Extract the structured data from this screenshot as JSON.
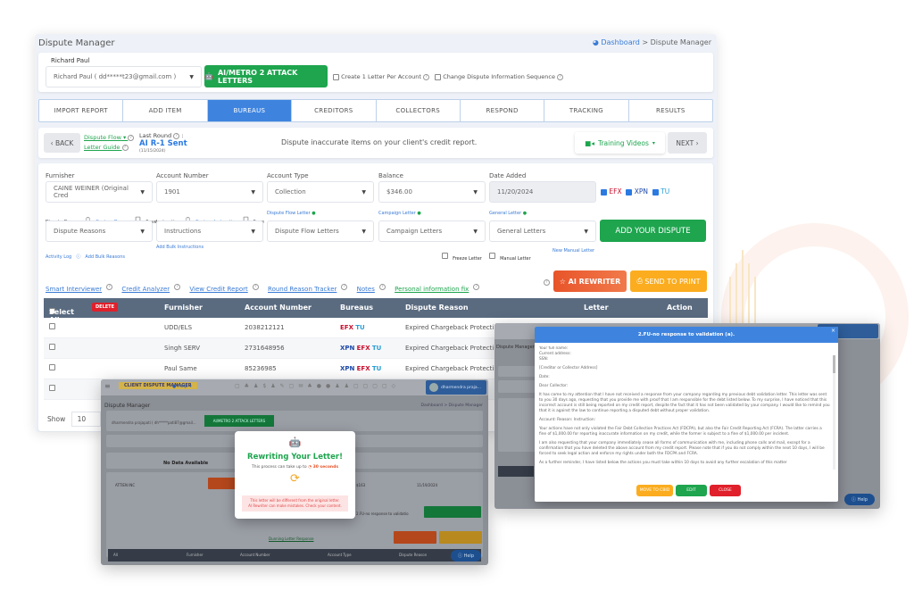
{
  "main": {
    "page_title": "Dispute Manager",
    "breadcrumb": {
      "home": "Dashboard",
      "sep": ">",
      "current": "Dispute Manager"
    },
    "client": {
      "label": "Richard Paul",
      "select_value": "Richard Paul ( dd*****t23@gmail.com )"
    },
    "attack_button": "AI/METRO 2 ATTACK LETTERS",
    "option_one_letter": "Create 1 Letter Per Account",
    "option_sequence": "Change Dispute Information Sequence",
    "tabs": [
      {
        "label": "IMPORT REPORT",
        "active": false
      },
      {
        "label": "ADD ITEM",
        "active": false
      },
      {
        "label": "BUREAUS",
        "active": true
      },
      {
        "label": "CREDITORS",
        "active": false
      },
      {
        "label": "COLLECTORS",
        "active": false
      },
      {
        "label": "RESPOND",
        "active": false
      },
      {
        "label": "TRACKING",
        "active": false
      },
      {
        "label": "RESULTS",
        "active": false
      }
    ],
    "nav": {
      "back": "BACK",
      "next": "NEXT",
      "dispute_flow": "Dispute Flow",
      "letter_guide": "Letter Guide",
      "last_round_label": "Last Round",
      "last_round_value": "AI R-1 Sent",
      "last_round_date": "(11/15/2024)",
      "instruction": "Dispute inaccurate items on your client's credit report.",
      "training_videos": "Training Videos"
    },
    "form": {
      "furnisher_label": "Furnisher",
      "furnisher_value": "CAINE WEINER (Original Cred",
      "account_number_label": "Account Number",
      "account_number_value": "1901",
      "account_type_label": "Account Type",
      "account_type_value": "Collection",
      "balance_label": "Balance",
      "balance_value": "$346.00",
      "date_added_label": "Date Added",
      "date_added_value": "11/20/2024",
      "bureaus": [
        {
          "code": "EFX",
          "checked": true,
          "color": "#c8102e"
        },
        {
          "code": "XPN",
          "checked": true,
          "color": "#1f4aa8"
        },
        {
          "code": "TU",
          "checked": true,
          "color": "#2a9fd6"
        }
      ],
      "dispute_reason_label": "Dispute Reason",
      "custom_reason": "Custom Reason",
      "save": "Save",
      "instruction_label": "Instruction",
      "custom_instruction": "Custom Instruction",
      "dispute_flow_letter": "Dispute Flow Letter",
      "campaign_letter": "Campaign Letter",
      "general_letter": "General Letter",
      "dispute_reasons_value": "Dispute Reasons",
      "instructions_value": "Instructions",
      "dispute_flow_letters_value": "Dispute Flow Letters",
      "campaign_letters_value": "Campaign Letters",
      "general_letters_value": "General Letters",
      "add_dispute": "ADD YOUR DISPUTE",
      "activity_log": "Activity Log",
      "add_bulk_reasons": "Add Bulk Reasons",
      "add_bulk_instructions": "Add Bulk Instructions",
      "freeze_letter": "Freeze Letter",
      "manual_letter": "Manual Letter",
      "new_manual_letter": "New Manual Letter"
    },
    "tools": [
      "Smart Interviewer",
      "Credit Analyzer",
      "View Credit Report",
      "Round Reason Tracker",
      "Notes"
    ],
    "personal_fix": "Personal information fix",
    "ai_rewriter": "AI REWRITER",
    "send_to_print": "SEND TO PRINT",
    "table": {
      "select_all": "Select All",
      "delete": "DELETE",
      "columns": [
        "Furnisher",
        "Account Number",
        "Bureaus",
        "Dispute Reason",
        "Letter",
        "Action"
      ],
      "rows": [
        {
          "furnisher": "UDD/ELS",
          "account": "2038212121",
          "bureaus": [
            "EFX",
            "TU"
          ],
          "reason": "Expired Chargeback Protecti"
        },
        {
          "furnisher": "Singh SERV",
          "account": "2731648956",
          "bureaus": [
            "XPN",
            "EFX",
            "TU"
          ],
          "reason": "Expired Chargeback Protecti"
        },
        {
          "furnisher": "Paul Same",
          "account": "85236985",
          "bureaus": [
            "XPN",
            "EFX",
            "TU"
          ],
          "reason": "Expired Chargeback Protecti"
        },
        {
          "furnisher": "",
          "account": "",
          "bureaus": [],
          "reason": ""
        }
      ],
      "show_label": "Show",
      "show_value": "10"
    }
  },
  "rewriter_shot": {
    "app_name": "CLIENT DISPUTE MANAGER",
    "help": "Help",
    "user": "dharmendra praja...",
    "page_title": "Dispute Manager",
    "breadcrumb": "Dashboard > Dispute Manager",
    "client_select": "dharmendra prajapati ( dh*****pati87@gmail...",
    "attack_button": "AI/METRO 2 ATTACK LETTERS",
    "last_round": "No Data Available",
    "furnisher": "ATTIEN INC",
    "balance": "$163",
    "date_added": "11/19/2024",
    "general_letter": "2.FU-no response to validatio",
    "dunning": "Dunning Letter Response",
    "table_cols": [
      "All",
      "Furnisher",
      "Account Number",
      "Account Type",
      "Dispute Reason"
    ],
    "modal": {
      "title": "Rewriting Your Letter!",
      "subtitle": "This process can take up to",
      "duration": "30 seconds",
      "warning_1": "This letter will be different from the original letter.",
      "warning_2": "AI Rewriter can make mistakes. Check your content."
    },
    "help_button": "Help"
  },
  "letter_shot": {
    "modal_title": "2.FU-no response to validation (a).",
    "lines": [
      "Your full name:",
      "Current address:",
      "SSN:",
      "[Creditor or Collector Address]",
      "Date:",
      "Dear Collector:",
      "It has come to my attention that I have not received a response from your company regarding my previous debt validation letter. This letter was sent to you 30 days ago, requesting that you provide me with proof that I am responsible for the debt listed below. To my surprise, I have noticed that this incorrect account is still being reported on my credit report, despite the fact that it has not been validated by your company. I would like to remind you that it is against the law to continue reporting a disputed debt without proper validation.",
      "Account: Reason: Instruction:",
      "Your actions have not only violated the Fair Debt Collection Practices Act (FDCPA), but also the Fair Credit Reporting Act (FCRA). The latter carries a fine of $1,000.00 for reporting inaccurate information on my credit, while the former is subject to a fine of $1,000.00 per incident.",
      "I am also requesting that your company immediately cease all forms of communication with me, including phone calls and mail, except for a confirmation that you have deleted the above account from my credit report. Please note that if you do not comply within the next 10 days, I will be forced to seek legal action and enforce my rights under both the FDCPA and FCRA.",
      "As a further reminder, I have listed below the actions you must take within 10 days to avoid any further escalation of this matter"
    ],
    "buttons": {
      "move": "MOVE TO CBID",
      "edit": "EDIT",
      "close": "CLOSE"
    },
    "help_button": "Help"
  }
}
